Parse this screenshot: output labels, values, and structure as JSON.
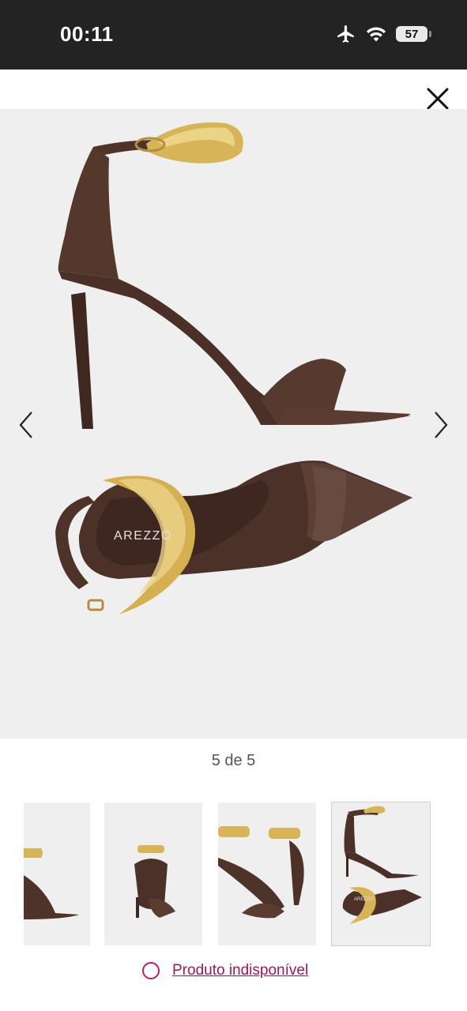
{
  "status_bar": {
    "time": "00:11",
    "battery_level": "57",
    "icons": [
      "airplane-mode-icon",
      "wifi-icon",
      "battery-icon"
    ]
  },
  "gallery": {
    "brand_on_insole": "AREZZO",
    "counter": "5 de 5",
    "current_index": 5,
    "total": 5
  },
  "thumbnails": [
    {
      "name": "thumbnail-partial"
    },
    {
      "name": "thumbnail-back"
    },
    {
      "name": "thumbnail-angle"
    },
    {
      "name": "thumbnail-combo",
      "active": true
    }
  ],
  "availability": {
    "label": "Produto indisponível"
  },
  "colors": {
    "status_bar_bg": "#232323",
    "image_bg": "#efefef",
    "leather_brown": "#4e3328",
    "gold": "#d7b556",
    "link_red": "#a0174d"
  }
}
